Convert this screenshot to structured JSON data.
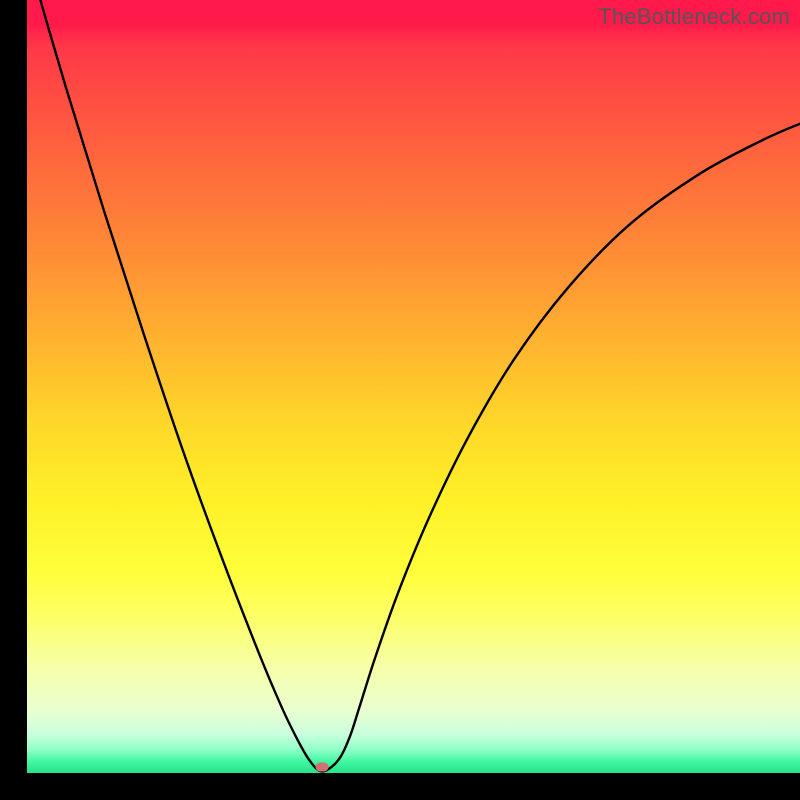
{
  "watermark": "TheBottleneck.com",
  "marker": {
    "x_frac": 0.381,
    "y_frac": 0.992
  },
  "chart_data": {
    "type": "line",
    "title": "",
    "xlabel": "",
    "ylabel": "",
    "xlim": [
      0,
      1
    ],
    "ylim": [
      0,
      1
    ],
    "series": [
      {
        "name": "bottleneck-curve",
        "x": [
          0.0,
          0.05,
          0.1,
          0.15,
          0.2,
          0.25,
          0.3,
          0.33,
          0.35,
          0.365,
          0.378,
          0.39,
          0.405,
          0.418,
          0.43,
          0.45,
          0.48,
          0.52,
          0.57,
          0.63,
          0.7,
          0.78,
          0.87,
          0.95,
          1.0
        ],
        "values": [
          1.06,
          0.888,
          0.726,
          0.571,
          0.422,
          0.284,
          0.155,
          0.084,
          0.043,
          0.017,
          0.003,
          0.005,
          0.02,
          0.048,
          0.085,
          0.148,
          0.233,
          0.33,
          0.433,
          0.535,
          0.628,
          0.71,
          0.775,
          0.818,
          0.84
        ]
      }
    ],
    "gradient_stops": [
      {
        "pos": 0.0,
        "color": "#ff1a4b"
      },
      {
        "pos": 0.5,
        "color": "#ffd829"
      },
      {
        "pos": 0.8,
        "color": "#fdff68"
      },
      {
        "pos": 1.0,
        "color": "#26e28b"
      }
    ]
  }
}
